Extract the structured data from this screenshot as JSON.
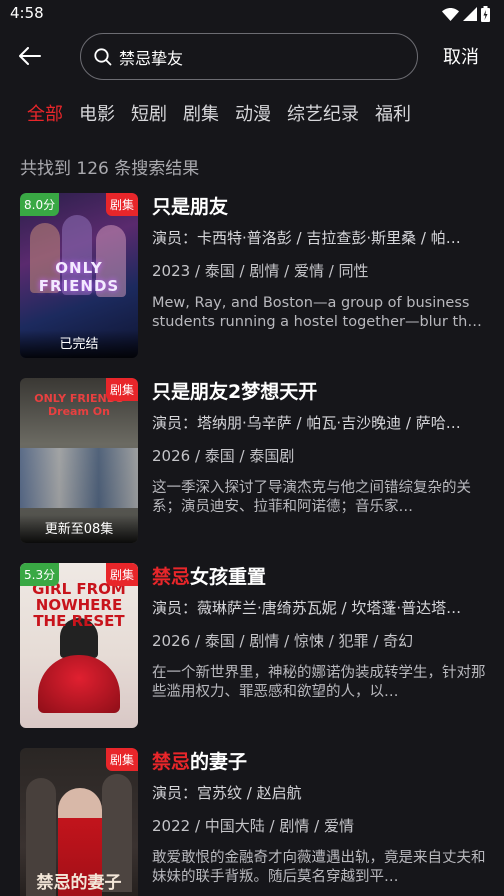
{
  "status": {
    "time": "4:58"
  },
  "search": {
    "query": "禁忌挚友",
    "cancel_label": "取消"
  },
  "tabs": [
    "全部",
    "电影",
    "短剧",
    "剧集",
    "动漫",
    "综艺纪录",
    "福利"
  ],
  "result_count": "共找到 126 条搜索结果",
  "results": [
    {
      "title": "只是朋友",
      "title_highlight": "",
      "score": "8.0分",
      "type": "剧集",
      "status": "已完结",
      "poster_text": "ONLY FRIENDS",
      "cast": "演员：卡西特·普洛彭 / 吉拉查彭·斯里桑 / 帕…",
      "meta": "2023 / 泰国 / 剧情 / 爱情 / 同性",
      "desc": "Mew, Ray, and Boston—a group of business students running a hostel together—blur the l…"
    },
    {
      "title": "只是朋友2梦想天开",
      "title_highlight": "",
      "score": "",
      "type": "剧集",
      "status": "更新至08集",
      "poster_text": "ONLY FRIENDS Dream On",
      "cast": "演员：塔纳朋·乌辛萨 / 帕瓦·吉沙晚迪 / 萨哈…",
      "meta": "2026 / 泰国 / 泰国剧",
      "desc": "这一季深入探讨了导演杰克与他之间错综复杂的关系；演员迪安、拉菲和阿诺德；音乐家…"
    },
    {
      "title": "女孩重置",
      "title_highlight": "禁忌",
      "score": "5.3分",
      "type": "剧集",
      "status": "",
      "poster_text": "GIRL FROM NOWHERE THE RESET",
      "cast": "演员：薇琳萨兰·唐绮苏瓦妮 / 坎塔蓬·普达塔…",
      "meta": "2026 / 泰国 / 剧情 / 惊悚 / 犯罪 / 奇幻",
      "desc": "在一个新世界里，神秘的娜诺伪装成转学生，针对那些滥用权力、罪恶感和欲望的人，以…"
    },
    {
      "title": "的妻子",
      "title_highlight": "禁忌",
      "score": "",
      "type": "剧集",
      "status": "",
      "poster_text": "禁忌的妻子",
      "cast": "演员：宫苏纹 / 赵启航",
      "meta": "2022 / 中国大陆 / 剧情 / 爱情",
      "desc": "敢爱敢恨的金融奇才向薇遭遇出轨，竟是来自丈夫和妹妹的联手背叛。随后莫名穿越到平…"
    }
  ]
}
